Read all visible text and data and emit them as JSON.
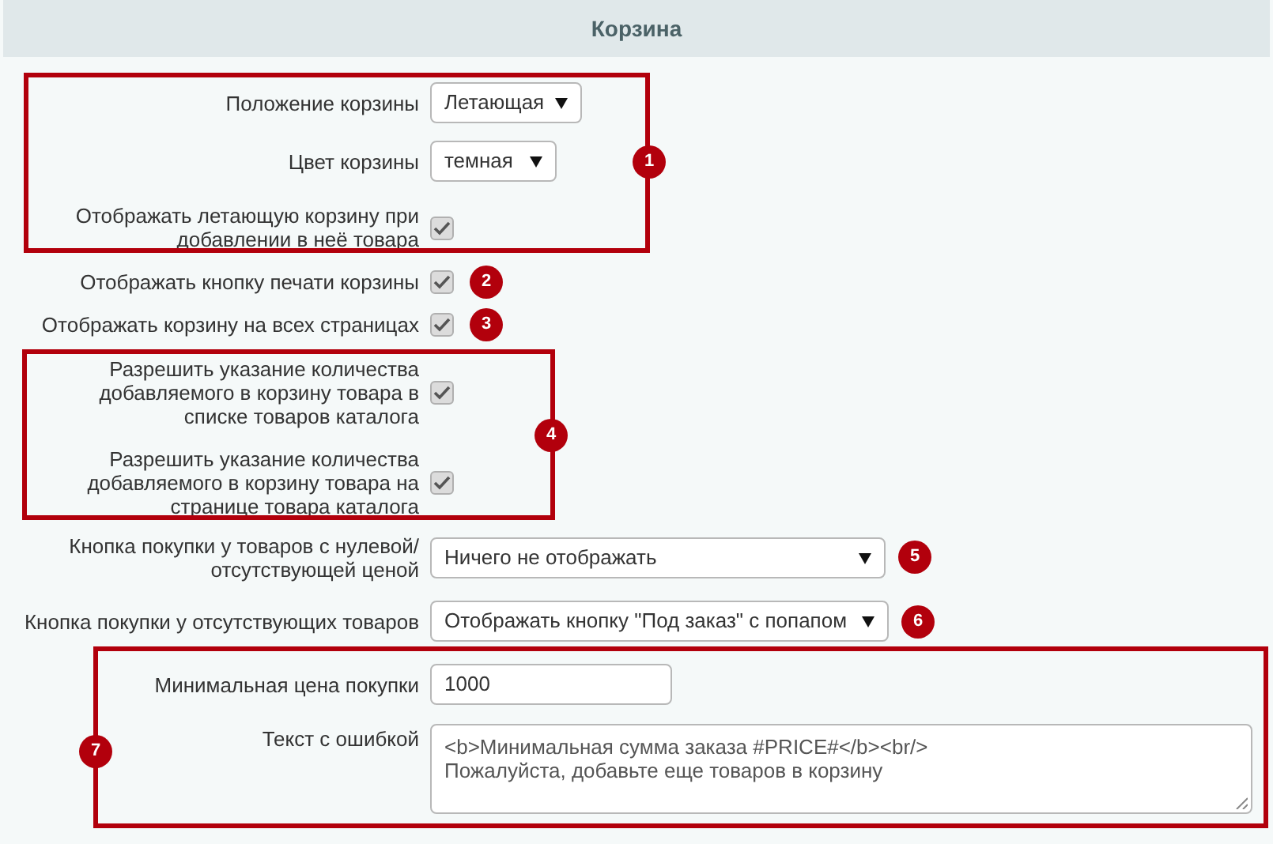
{
  "header": {
    "title": "Корзина"
  },
  "rows": [
    {
      "kind": "select",
      "label": "Положение корзины",
      "value": "Летающая"
    },
    {
      "kind": "select",
      "label": "Цвет корзины",
      "value": "темная"
    },
    {
      "kind": "checkbox",
      "label": "Отображать летающую корзину при добавлении в неё товара",
      "checked": true
    },
    {
      "kind": "checkbox",
      "label": "Отображать кнопку печати корзины",
      "checked": true
    },
    {
      "kind": "checkbox",
      "label": "Отображать корзину на всех страницах",
      "checked": true
    },
    {
      "kind": "checkbox",
      "label": "Разрешить указание количества добавляемого в корзину товара в списке товаров каталога",
      "checked": true
    },
    {
      "kind": "checkbox",
      "label": "Разрешить указание количества добавляемого в корзину товара на странице товара каталога",
      "checked": true
    },
    {
      "kind": "select",
      "label": "Кнопка покупки у товаров с нулевой/ отсутствующей ценой",
      "value": "Ничего не отображать"
    },
    {
      "kind": "select",
      "label": "Кнопка покупки у отсутствующих товаров",
      "value": "Отображать кнопку \"Под заказ\" с попапом"
    },
    {
      "kind": "input",
      "label": "Минимальная цена покупки",
      "value": "1000"
    },
    {
      "kind": "textarea",
      "label": "Текст с ошибкой",
      "value": "<b>Минимальная сумма заказа #PRICE#</b><br/>\nПожалуйста, добавьте еще товаров в корзину"
    }
  ],
  "annotations": [
    {
      "number": "1"
    },
    {
      "number": "2"
    },
    {
      "number": "3"
    },
    {
      "number": "4"
    },
    {
      "number": "5"
    },
    {
      "number": "6"
    },
    {
      "number": "7"
    }
  ]
}
